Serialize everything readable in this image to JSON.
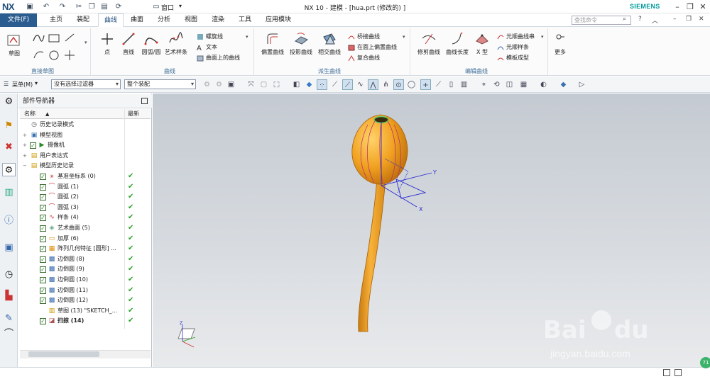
{
  "titlebar": {
    "logo": "NX",
    "title": "NX 10 - 建模 - [hua.prt  (修改的) ]",
    "window_menu": "窗口",
    "brand": "SIEMENS"
  },
  "menu": {
    "file": "文件(F)",
    "tabs": [
      "主页",
      "装配",
      "曲线",
      "曲面",
      "分析",
      "视图",
      "渲染",
      "工具",
      "应用模块"
    ],
    "active_tab": "曲线",
    "search_placeholder": "查找命令"
  },
  "ribbon": {
    "sketch_label": "草图",
    "direct_sketch_group": "直接草图",
    "curve_group": "曲线",
    "curve_buttons": [
      "点",
      "直线",
      "圆弧/圆",
      "艺术样条"
    ],
    "curve_small": [
      "螺旋线",
      "文本",
      "曲面上的曲线"
    ],
    "derived_group": "派生曲线",
    "derived_buttons": [
      "偏置曲线",
      "投影曲线",
      "相交曲线"
    ],
    "derived_small": [
      "桥接曲线",
      "在面上偏置曲线",
      "复合曲线"
    ],
    "edit_group": "编辑曲线",
    "edit_buttons": [
      "修剪曲线",
      "曲线长度",
      "X 型"
    ],
    "edit_small": [
      "光顺曲线串",
      "光顺样条",
      "模板成型"
    ],
    "more": "更多"
  },
  "toolbar": {
    "menu_button": "菜单(M)",
    "filter_value": "没有选择过滤器",
    "scope_value": "整个装配"
  },
  "navigator": {
    "title": "部件导航器",
    "col_name": "名称",
    "col_latest": "最新",
    "rows": [
      {
        "label": "历史记录模式",
        "indent": 0,
        "check": false,
        "ok": false
      },
      {
        "label": "模型视图",
        "indent": 0,
        "check": false,
        "ok": false
      },
      {
        "label": "摄像机",
        "indent": 0,
        "check": true,
        "ok": false
      },
      {
        "label": "用户表达式",
        "indent": 0,
        "check": false,
        "ok": false
      },
      {
        "label": "模型历史记录",
        "indent": 0,
        "check": false,
        "ok": false
      },
      {
        "label": "基准坐标系 (0)",
        "indent": 1,
        "check": true,
        "ok": true
      },
      {
        "label": "圆弧 (1)",
        "indent": 1,
        "check": true,
        "ok": true
      },
      {
        "label": "圆弧 (2)",
        "indent": 1,
        "check": true,
        "ok": true
      },
      {
        "label": "圆弧 (3)",
        "indent": 1,
        "check": true,
        "ok": true
      },
      {
        "label": "样条 (4)",
        "indent": 1,
        "check": true,
        "ok": true
      },
      {
        "label": "艺术曲面 (5)",
        "indent": 1,
        "check": true,
        "ok": true
      },
      {
        "label": "加厚 (6)",
        "indent": 1,
        "check": true,
        "ok": true
      },
      {
        "label": "阵列几何特征 [圆形] ...",
        "indent": 1,
        "check": true,
        "ok": true
      },
      {
        "label": "边倒圆 (8)",
        "indent": 1,
        "check": true,
        "ok": true
      },
      {
        "label": "边倒圆 (9)",
        "indent": 1,
        "check": true,
        "ok": true
      },
      {
        "label": "边倒圆 (10)",
        "indent": 1,
        "check": true,
        "ok": true
      },
      {
        "label": "边倒圆 (11)",
        "indent": 1,
        "check": true,
        "ok": true
      },
      {
        "label": "边倒圆 (12)",
        "indent": 1,
        "check": true,
        "ok": true
      },
      {
        "label": "草图 (13) \"SKETCH_...",
        "indent": 1,
        "check": false,
        "ok": true
      },
      {
        "label": "扫掠 (14)",
        "indent": 1,
        "check": true,
        "ok": true
      }
    ]
  },
  "viewport": {
    "axis_y": "Y",
    "axis_x": "X",
    "axis_z": "Z",
    "watermark": "jingyan.baidu.com"
  },
  "colors": {
    "accent": "#2b5c8f",
    "model_orange": "#f0a020",
    "check_green": "#2aa52a"
  }
}
